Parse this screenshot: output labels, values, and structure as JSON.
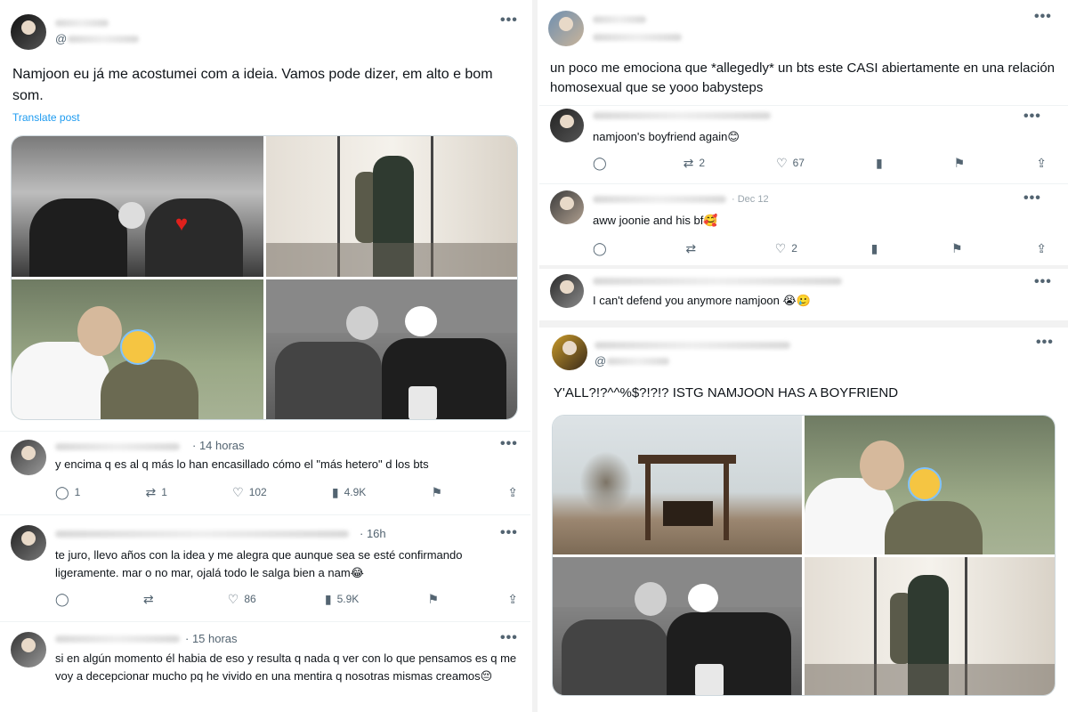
{
  "left": {
    "main_post": {
      "text": "Namjoon eu já me acostumei com a ideia. Vamos pode dizer, em alto e bom som.",
      "translate": "Translate post",
      "handle_prefix": "@"
    },
    "replies": [
      {
        "time": "· 14 horas",
        "text": "y encima q es al q más lo han encasillado cómo el \"más hetero\" d los bts",
        "replies": "1",
        "reposts": "1",
        "likes": "102",
        "views": "4.9K"
      },
      {
        "time": "· 16h",
        "text": "te juro, llevo años con la idea y me alegra que aunque sea se esté confirmando ligeramente. mar o no mar, ojalá todo le salga bien a nam😂",
        "replies": "",
        "reposts": "",
        "likes": "86",
        "views": "5.9K"
      },
      {
        "time": "· 15 horas",
        "text": "si en algún momento él habia de eso y resulta q nada q ver con lo que pensamos es q me voy a decepcionar mucho pq he vivido en una mentira q nosotras mismas creamos😔"
      }
    ]
  },
  "right": {
    "top_post": {
      "text": "un poco me emociona que *allegedly* un bts este CASI abiertamente en una relación homosexual que se yooo babysteps"
    },
    "replies": [
      {
        "text": "namjoon's boyfriend again😊",
        "replies": "",
        "reposts": "2",
        "likes": "67"
      },
      {
        "text": "aww joonie and his bf🥰",
        "time": "· Dec 12",
        "replies": "",
        "reposts": "",
        "likes": "2"
      },
      {
        "text": "I can't defend you anymore namjoon 😭🥲"
      }
    ],
    "yall_post": {
      "handle": "@",
      "text": "Y'ALL?!?^^%$?!?!? ISTG NAMJOON HAS A BOYFRIEND"
    }
  },
  "icons": {
    "more": "more-horizontal-icon",
    "reply": "reply-icon",
    "repost": "repost-icon",
    "like": "heart-icon",
    "views": "views-icon",
    "bookmark": "bookmark-icon",
    "share": "share-icon"
  },
  "colors": {
    "link": "#1d9bf0",
    "muted": "#536471",
    "border": "#cfd9de"
  }
}
